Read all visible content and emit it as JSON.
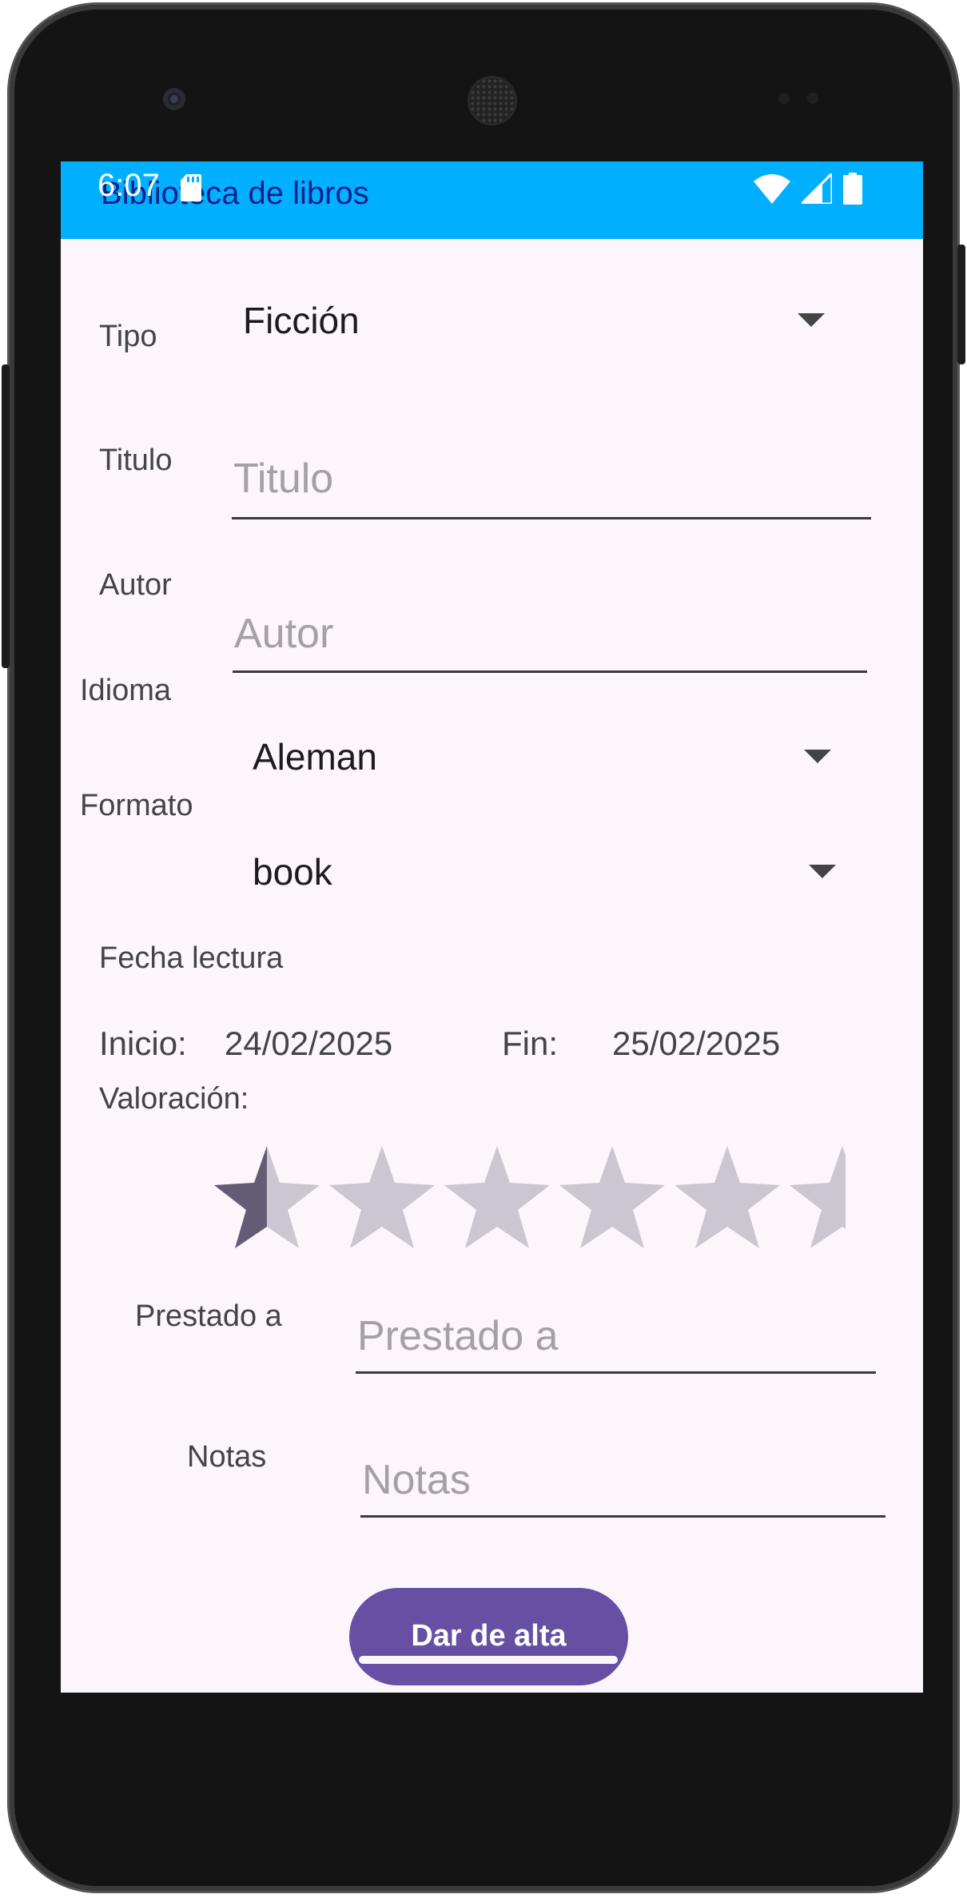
{
  "app": {
    "title": "Biblioteca de libros"
  },
  "status_bar": {
    "time": "6:07",
    "icons": [
      "sd-card-icon",
      "wifi-icon",
      "signal-icon",
      "battery-icon"
    ]
  },
  "form": {
    "tipo": {
      "label": "Tipo",
      "value": "Ficción"
    },
    "titulo": {
      "label": "Titulo",
      "placeholder": "Titulo",
      "value": ""
    },
    "autor": {
      "label": "Autor",
      "placeholder": "Autor",
      "value": ""
    },
    "idioma": {
      "label": "Idioma",
      "value": "Aleman"
    },
    "formato": {
      "label": "Formato",
      "value": "book"
    },
    "fecha_lectura": {
      "heading": "Fecha lectura",
      "inicio_label": "Inicio:",
      "inicio_value": "24/02/2025",
      "fin_label": "Fin:",
      "fin_value": "25/02/2025"
    },
    "valoracion": {
      "label": "Valoración:",
      "rating": 0.5,
      "max": 5
    },
    "prestado": {
      "label": "Prestado a",
      "placeholder": "Prestado a",
      "value": ""
    },
    "notas": {
      "label": "Notas",
      "placeholder": "Notas",
      "value": ""
    },
    "submit_label": "Dar de alta"
  },
  "colors": {
    "appbar": "#00b0ff",
    "title_text": "#0d1f8a",
    "background": "#fcf5fb",
    "button": "#6750a4",
    "star_filled": "#645c75",
    "star_empty": "#cbc6cf"
  }
}
